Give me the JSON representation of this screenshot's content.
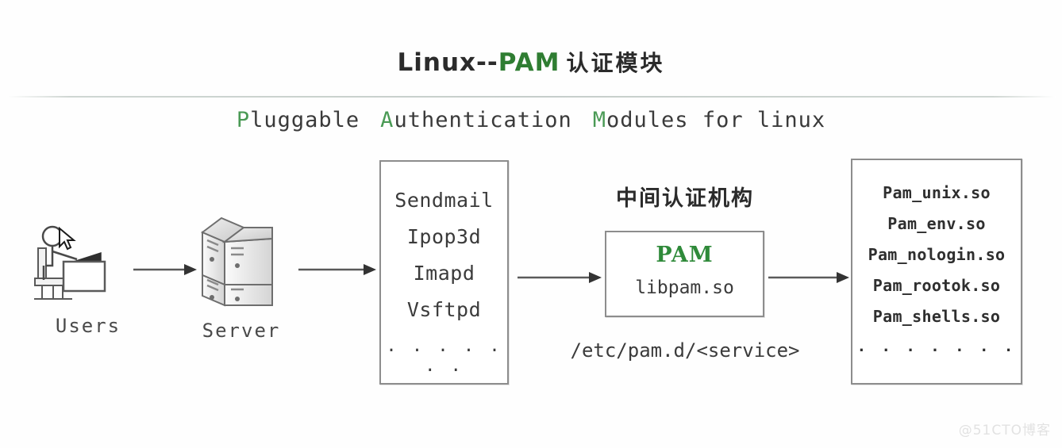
{
  "title": {
    "main": "Linux--",
    "accent": "PAM",
    "chinese": "认证模块"
  },
  "subtitle": {
    "word1_initial": "P",
    "word1_rest": "luggable",
    "word2_initial": "A",
    "word2_rest": "uthentication",
    "word3_initial": "M",
    "word3_rest": "odules for linux"
  },
  "users": {
    "label": "Users",
    "icon": "user-at-desk-icon",
    "cursor": "mouse-pointer-icon"
  },
  "server": {
    "label": "Server",
    "icon": "server-rack-icon"
  },
  "services": {
    "items": [
      "Sendmail",
      "Ipop3d",
      "Imapd",
      "Vsftpd"
    ],
    "ellipsis": ". . . . . . ."
  },
  "pam": {
    "heading": "中间认证机构",
    "box_title": "PAM",
    "box_library": "libpam.so",
    "config_path": "/etc/pam.d/<service>"
  },
  "modules": {
    "items": [
      "Pam_unix.so",
      "Pam_env.so",
      "Pam_nologin.so",
      "Pam_rootok.so",
      "Pam_shells.so"
    ],
    "ellipsis": ". . . . . . ."
  },
  "arrows": [
    {
      "name": "arrow-users-to-server"
    },
    {
      "name": "arrow-server-to-services"
    },
    {
      "name": "arrow-services-to-pam"
    },
    {
      "name": "arrow-pam-to-modules"
    }
  ],
  "watermark": "@51CTO博客",
  "colors": {
    "accent_green": "#2f7d32",
    "subtitle_green": "#4a9a55",
    "box_border": "#8d8d8d",
    "text": "#3b3b3b",
    "arrow": "#555555",
    "watermark": "#e2e2e2"
  }
}
